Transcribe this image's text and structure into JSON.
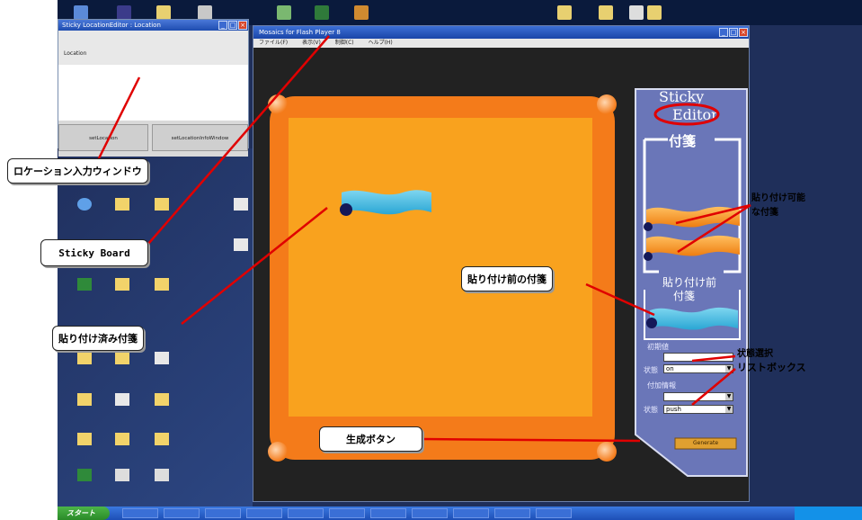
{
  "location_window": {
    "title": "Sticky LocationEditor : Location",
    "location_label": "Location",
    "buttons": [
      "setLocation",
      "setLocationInfoWindow"
    ]
  },
  "main_window": {
    "title": "Mosaics for Flash Player 8",
    "menu": [
      "ファイル(F)",
      "表示(V)",
      "制御(C)",
      "ヘルプ(H)"
    ]
  },
  "editor": {
    "title_line1": "Sticky",
    "title_line2": "Editor",
    "section_fusen": "付箋",
    "section_before": "貼り付け前",
    "section_before2": "付箋",
    "field1_label": "初期値",
    "state_label": "状態",
    "state1_value": "on",
    "field2_label": "付加情報",
    "state2_value": "push",
    "create_button": "Generate"
  },
  "callouts": {
    "location_window": "ロケーション入力ウィンドウ",
    "sticky_board": "Sticky Board",
    "pasted_sticky": "貼り付け済み付箋",
    "before_paste": "貼り付け前の付箋",
    "create_button": "生成ボタン",
    "pasteable_line1": "貼り付け可能",
    "pasteable_line2": "な付箋",
    "state_select_line1": "状態選択",
    "state_select_line2": "リストボックス"
  },
  "taskbar": {
    "start": "スタート",
    "items": [
      "",
      "",
      "",
      "",
      "",
      "",
      "",
      "",
      "",
      "",
      ""
    ],
    "clock": ""
  },
  "colors": {
    "board_outer": "#f47b1a",
    "board_inner": "#f9a21e",
    "editor_panel": "#6a76b8",
    "sticky_blue": "#4bbfe0",
    "sticky_orange": "#f59a1c",
    "callout_line": "#e00000"
  }
}
